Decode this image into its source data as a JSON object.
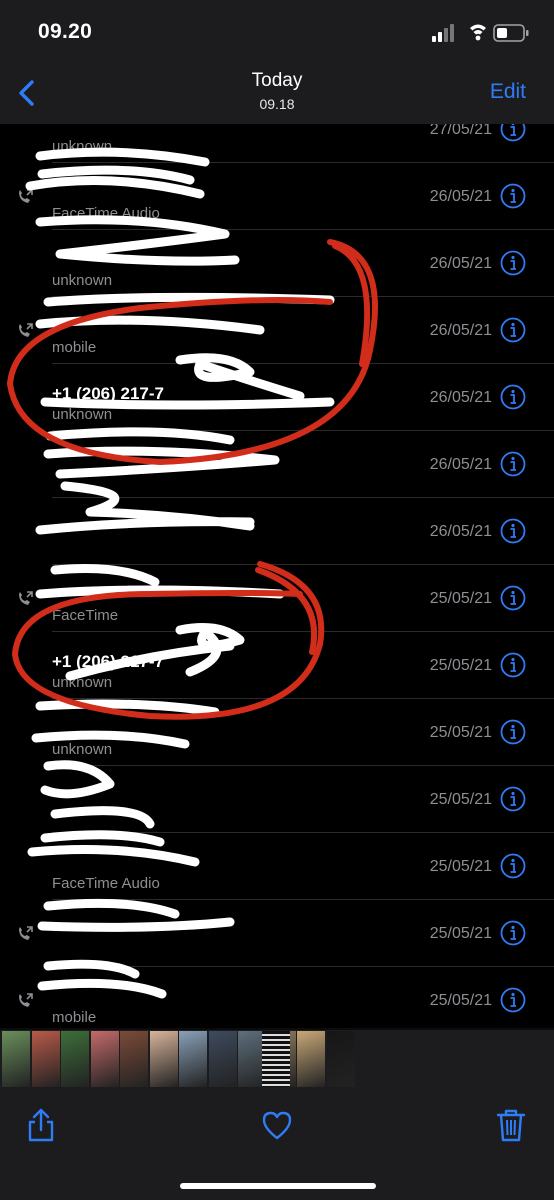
{
  "status": {
    "time": "09.20"
  },
  "nav": {
    "title": "Today",
    "subtitle": "09.18",
    "edit_label": "Edit"
  },
  "colors": {
    "accent": "#2f7cf6",
    "scribble_red": "#d12d1a"
  },
  "rows": [
    {
      "name": "",
      "sub": "unknown",
      "date": "27/05/21",
      "call_icon": false
    },
    {
      "name": "",
      "sub": "FaceTime Audio",
      "date": "26/05/21",
      "call_icon": true
    },
    {
      "name": "",
      "sub": "unknown",
      "date": "26/05/21",
      "call_icon": false
    },
    {
      "name": "",
      "sub": "mobile",
      "date": "26/05/21",
      "call_icon": true
    },
    {
      "name": "+1 (206) 217-7",
      "sub": "unknown",
      "date": "26/05/21",
      "call_icon": false
    },
    {
      "name": "",
      "sub": "",
      "date": "26/05/21",
      "call_icon": false
    },
    {
      "name": "",
      "sub": "",
      "date": "26/05/21",
      "call_icon": false
    },
    {
      "name": "",
      "sub": "FaceTime",
      "date": "25/05/21",
      "call_icon": true
    },
    {
      "name": "+1 (206) 217-7",
      "sub": "unknown",
      "date": "25/05/21",
      "call_icon": false
    },
    {
      "name": "",
      "sub": "unknown",
      "date": "25/05/21",
      "call_icon": false
    },
    {
      "name": "",
      "sub": "",
      "date": "25/05/21",
      "call_icon": false
    },
    {
      "name": "",
      "sub": "FaceTime Audio",
      "date": "25/05/21",
      "call_icon": false
    },
    {
      "name": "",
      "sub": "",
      "date": "25/05/21",
      "call_icon": true
    },
    {
      "name": "",
      "sub": "mobile",
      "date": "25/05/21",
      "call_icon": true
    }
  ],
  "filmstrip": {
    "thumb_colors": [
      "#6b8f5c",
      "#b95a48",
      "#3e6e3a",
      "#c46a6a",
      "#7b4b38",
      "#d9b49a",
      "#8aa0b8",
      "#3d4a5e",
      "#5e6f7c",
      "#8f7b5d",
      "#c9a878",
      "#161616",
      "#dcdcdc"
    ]
  },
  "toolbar": {
    "icons": [
      "share-icon",
      "heart-icon",
      "trash-icon"
    ]
  }
}
